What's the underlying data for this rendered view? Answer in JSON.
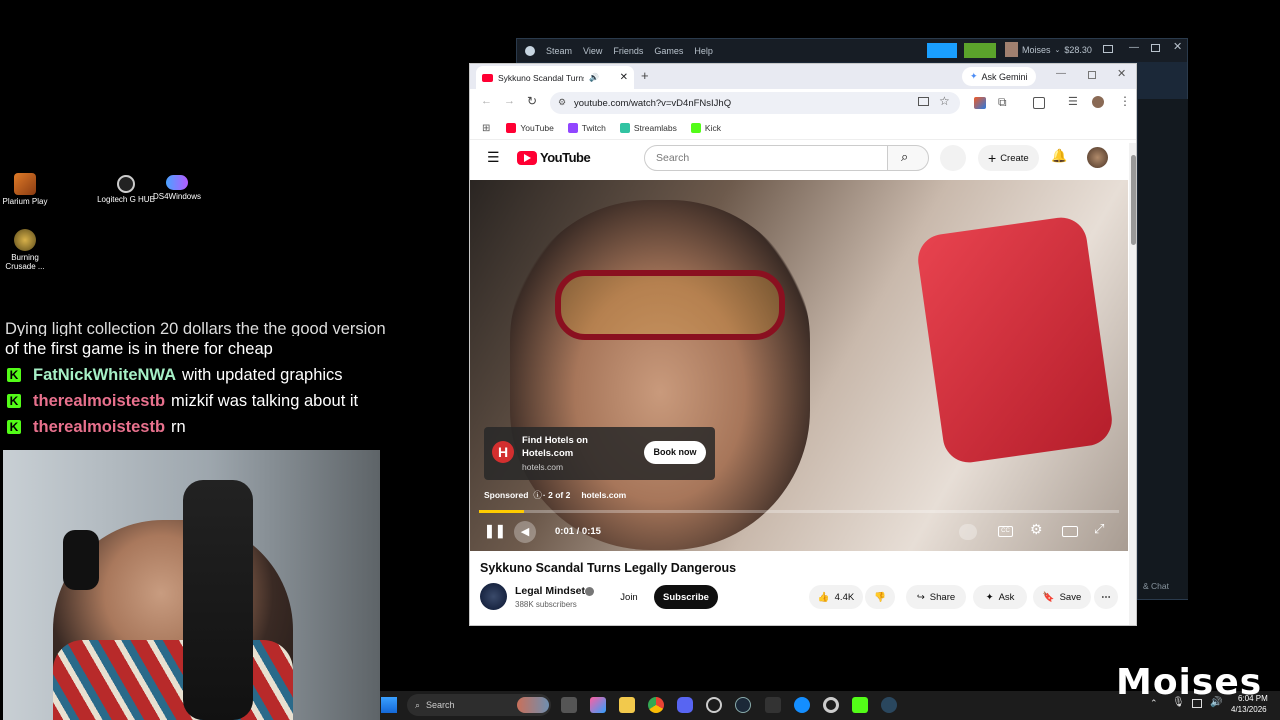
{
  "desktop_icons": [
    {
      "label": "Plarium Play"
    },
    {
      "label": "Logitech G HUB"
    },
    {
      "label": "DS4Windows"
    },
    {
      "label": "Burning Crusade ..."
    }
  ],
  "chat": {
    "partial_line": "Dying light collection 20 dollars the the good version",
    "first_line": "of the first game is in there for cheap",
    "messages": [
      {
        "user": "FatNickWhiteNWA",
        "text": "with updated graphics",
        "color": "#a6f0c6"
      },
      {
        "user": "therealmoistestb",
        "text": "mizkif was talking about it",
        "color": "#e8718d"
      },
      {
        "user": "therealmoistestb",
        "text": "rn",
        "color": "#e8718d"
      }
    ]
  },
  "steam": {
    "menu": [
      "Steam",
      "View",
      "Friends",
      "Games",
      "Help"
    ],
    "user": "Moises",
    "balance": "$28.30",
    "side_label": "& Chat"
  },
  "chrome": {
    "tab_title": "Sykkuno Scandal Turns Legally Dangerous",
    "gemini": "Ask Gemini",
    "url": "youtube.com/watch?v=vD4nFNsIJhQ",
    "bookmarks": [
      {
        "label": "YouTube",
        "color": "#ff0033"
      },
      {
        "label": "Twitch",
        "color": "#9146ff"
      },
      {
        "label": "Streamlabs",
        "color": "#31c3a2"
      },
      {
        "label": "Kick",
        "color": "#53fc18"
      }
    ]
  },
  "youtube": {
    "logo_text": "YouTube",
    "search_placeholder": "Search",
    "create_label": "Create",
    "ad": {
      "title": "Find Hotels on Hotels.com",
      "domain": "hotels.com",
      "cta": "Book now",
      "sponsored": "Sponsored",
      "count": "· 2 of 2",
      "site": "hotels.com",
      "progress": 0.07
    },
    "time": "0:01 / 0:15",
    "video_title": "Sykkuno Scandal Turns Legally Dangerous",
    "channel": "Legal Mindset",
    "subscribers": "388K subscribers",
    "join": "Join",
    "subscribe": "Subscribe",
    "likes": "4.4K",
    "share": "Share",
    "ask": "Ask",
    "save": "Save"
  },
  "taskbar": {
    "search": "Search",
    "time": "6:04 PM",
    "date": "4/13/2026"
  },
  "watermark": "Moises"
}
